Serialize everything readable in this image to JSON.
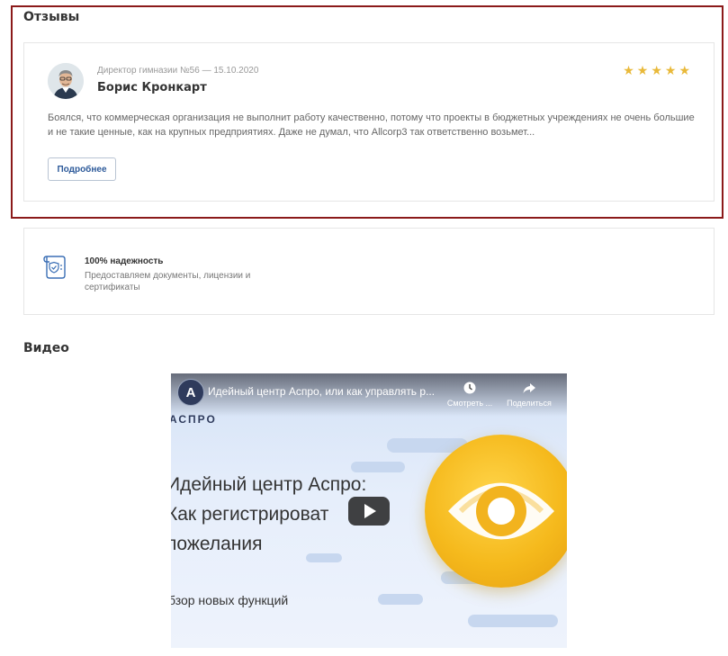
{
  "reviews": {
    "title": "Отзывы",
    "item": {
      "meta": "Директор гимназии №56 — 15.10.2020",
      "author": "Борис Кронкарт",
      "rating": 5,
      "text": "Боялся, что коммерческая организация не выполнит работу качественно, потому что проекты в бюджетных учреждениях не очень большие и не такие ценные, как на крупных предприятиях. Даже не думал, что Allcorp3 так ответственно возьмет...",
      "more_label": "Подробнее"
    },
    "star_color": "#e9b93a",
    "highlight_color": "#8b1a1a"
  },
  "reliability": {
    "title": "100% надежность",
    "description": "Предоставляем документы, лицензии и сертификаты",
    "icon": "document-shield-icon"
  },
  "video": {
    "title": "Видео",
    "player": {
      "channel_initial": "A",
      "video_title": "Идейный центр Аспро, или как управлять р...",
      "watch_later_label": "Смотреть ...",
      "share_label": "Поделиться",
      "brand": "АСПРО",
      "headline": "Идейный центр Аспро:\nКак регистрироват\nпожелания",
      "subtitle": "бзор новых функций"
    }
  }
}
